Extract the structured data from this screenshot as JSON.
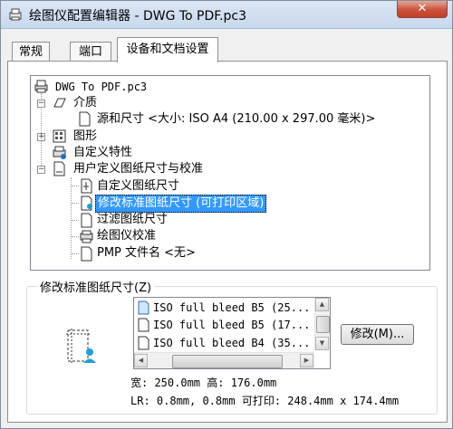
{
  "window": {
    "title": "绘图仪配置编辑器 - DWG To PDF.pc3",
    "close_label": "✕"
  },
  "tabs": [
    {
      "label": "常规"
    },
    {
      "label": "端口"
    },
    {
      "label": "设备和文档设置"
    }
  ],
  "tree": {
    "root": "DWG To PDF.pc3",
    "media": "介质",
    "media_source": "源和尺寸 <大小: ISO A4 (210.00 x 297.00 毫米)>",
    "graphics": "图形",
    "custom_props": "自定义特性",
    "user_paper": "用户定义图纸尺寸与校准",
    "custom_paper": "自定义图纸尺寸",
    "modify_std": "修改标准图纸尺寸 (可打印区域)",
    "filter_paper": "过滤图纸尺寸",
    "plotter_calib": "绘图仪校准",
    "pmp_file": "PMP 文件名 <无>"
  },
  "group": {
    "label": "修改标准图纸尺寸(Z)",
    "list_items": [
      "ISO full bleed B5 (25...",
      "ISO full bleed B5 (17...",
      "ISO full bleed B4 (35..."
    ],
    "modify_button": "修改(M)...",
    "size_line": "宽: 250.0mm 高: 176.0mm",
    "margin_line": "LR: 0.8mm, 0.8mm  可打印: 248.4mm x 174.4mm"
  }
}
